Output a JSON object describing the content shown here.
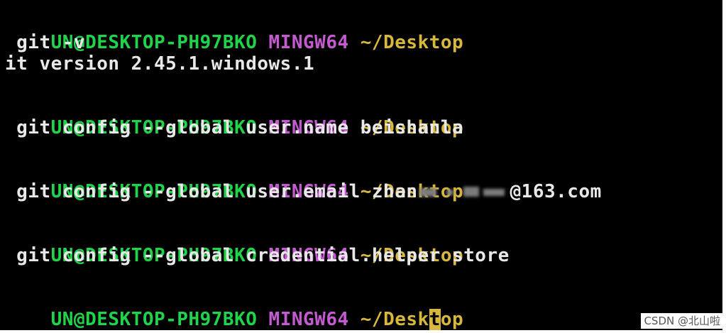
{
  "terminal": {
    "prompt_user": "UN@DESKTOP-PH97BKO",
    "prompt_system": "MINGW64",
    "prompt_path_pre_cursor": "~/Desk",
    "prompt_path_cursor_char": "t",
    "prompt_path_post_cursor": "op",
    "prompt_path": "~/Desktop",
    "entries": [
      {
        "command": " git -v",
        "output": "it version 2.45.1.windows.1"
      },
      {
        "command": " git config --global user.name beishanla"
      },
      {
        "command_prefix": " git config --global user.email zhan",
        "command_suffix": "@163.com"
      },
      {
        "command": " git config --global credential.helper store"
      }
    ]
  },
  "watermark": "CSDN @北山啦",
  "colors": {
    "background": "#000000",
    "user": "#1fd34a",
    "system": "#c45ad0",
    "path": "#d7b73c",
    "text": "#e8e8e8"
  }
}
